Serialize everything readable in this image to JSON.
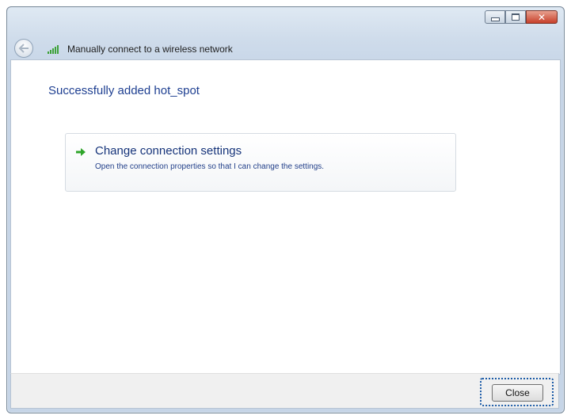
{
  "window": {
    "controls": {
      "minimize_icon": "minimize-icon",
      "maximize_icon": "maximize-icon",
      "close_icon": "close-icon",
      "close_glyph": "✕"
    }
  },
  "nav": {
    "back_icon": "back-arrow-icon",
    "network_icon": "wireless-signal-icon",
    "title": "Manually connect to a wireless network"
  },
  "content": {
    "heading": "Successfully added hot_spot",
    "command_link": {
      "icon": "green-arrow-icon",
      "title": "Change connection settings",
      "description": "Open the connection properties so that I can change the settings."
    }
  },
  "footer": {
    "close_label": "Close"
  },
  "colors": {
    "heading": "#1e3f91",
    "link": "#16347a",
    "arrow": "#2fa52a",
    "focus_ring": "#1a5aa6"
  }
}
